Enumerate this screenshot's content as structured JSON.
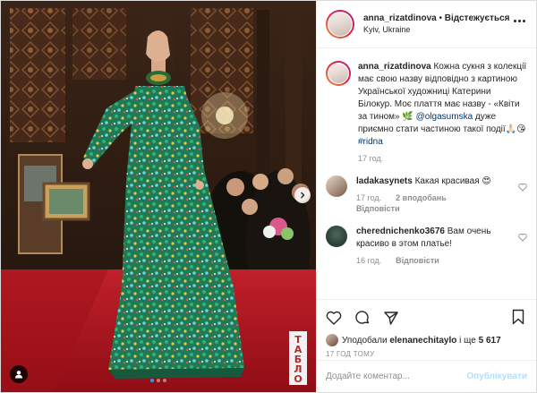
{
  "header": {
    "username": "anna_rizatdinova",
    "separator": " • ",
    "follow_label": "Відстежується",
    "location": "Kyiv, Ukraine"
  },
  "caption": {
    "username": "anna_rizatdinova",
    "text_1": "Кожна сукня з колекції має свою назву відповідно з картиною Української художниці Катерини Білокур. Моє плаття має назву - «Квіти за тином» 🌿",
    "mention": "@olgasumska",
    "text_2": "дуже приємно стати частиною такої події🙏🏻😘",
    "hashtag": "#ridna",
    "time": "17 год."
  },
  "comments": [
    {
      "username": "ladakasynets",
      "text": "Какая красивая 😍",
      "time": "17 год.",
      "likes": "2 вподобань",
      "reply": "Відповісти"
    },
    {
      "username": "cherednichenko3676",
      "text": "Вам очень красиво в этом платье!",
      "time": "16 год.",
      "likes": "",
      "reply": "Відповісти"
    }
  ],
  "likes": {
    "prefix": "Уподобали",
    "user": "elenanechitaylo",
    "suffix": "і ще",
    "count": "5 617"
  },
  "timestamp": "17 ГОД ТОМУ",
  "comment_input": {
    "placeholder": "Додайте коментар...",
    "post_label": "Опублікувати"
  },
  "photo": {
    "watermark": "ТАБЛО",
    "carousel_total": 3,
    "carousel_active": 1
  },
  "icons": {
    "like": "heart-icon",
    "comment": "comment-icon",
    "share": "share-icon",
    "save": "bookmark-icon",
    "next": "chevron-right-icon",
    "tag": "person-tag-icon",
    "more": "more-options-icon"
  },
  "colors": {
    "link": "#003569",
    "meta": "#8e8e8e",
    "post_button": "#b2dffc",
    "active_dot": "#3897f0",
    "dress_green": "#1f7a55",
    "carpet_red": "#b3121d"
  }
}
